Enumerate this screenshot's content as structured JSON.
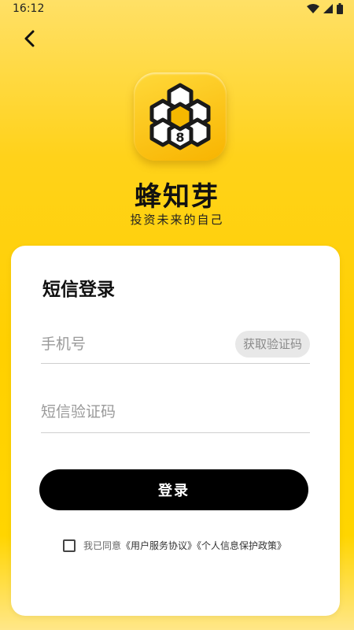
{
  "status_bar": {
    "time": "16:12"
  },
  "brand": {
    "name": "蜂知芽",
    "slogan": "投资未来的自己",
    "logo_badge": "8"
  },
  "login": {
    "title": "短信登录",
    "phone_placeholder": "手机号",
    "phone_value": "",
    "get_code_label": "获取验证码",
    "code_placeholder": "短信验证码",
    "code_value": "",
    "submit_label": "登录",
    "agreement_prefix": "我已同意",
    "terms_link": "《用户服务协议》",
    "privacy_link": "《个人信息保护政策》",
    "agreement_checked": false
  },
  "colors": {
    "background": "#ffd500",
    "card": "#ffffff",
    "primary_button": "#000000"
  }
}
